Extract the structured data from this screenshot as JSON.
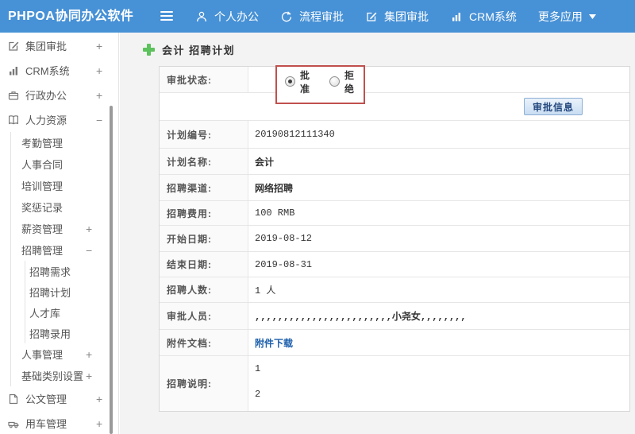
{
  "topbar": {
    "logo": "PHPOA协同办公软件",
    "nav": [
      {
        "label": "个人办公",
        "icon": "user-icon"
      },
      {
        "label": "流程审批",
        "icon": "process-icon"
      },
      {
        "label": "集团审批",
        "icon": "edit-square-icon"
      },
      {
        "label": "CRM系统",
        "icon": "bar-chart-icon"
      },
      {
        "label": "更多应用",
        "icon": "caret-down-icon"
      }
    ]
  },
  "sidebar": {
    "items": [
      {
        "label": "集团审批",
        "level": 0,
        "icon": "edit-square-icon",
        "expander": "+"
      },
      {
        "label": "CRM系统",
        "level": 0,
        "icon": "bar-chart-icon",
        "expander": "+"
      },
      {
        "label": "行政办公",
        "level": 0,
        "icon": "briefcase-icon",
        "expander": "+"
      },
      {
        "label": "人力资源",
        "level": 0,
        "icon": "book-icon",
        "expander": "−"
      },
      {
        "label": "考勤管理",
        "level": 1
      },
      {
        "label": "人事合同",
        "level": 1
      },
      {
        "label": "培训管理",
        "level": 1
      },
      {
        "label": "奖惩记录",
        "level": 1
      },
      {
        "label": "薪资管理",
        "level": 1,
        "expander": "+"
      },
      {
        "label": "招聘管理",
        "level": 1,
        "expander": "−"
      },
      {
        "label": "招聘需求",
        "level": 2
      },
      {
        "label": "招聘计划",
        "level": 2
      },
      {
        "label": "人才库",
        "level": 2
      },
      {
        "label": "招聘录用",
        "level": 2
      },
      {
        "label": "人事管理",
        "level": 1,
        "expander": "+"
      },
      {
        "label": "基础类别设置",
        "level": 1,
        "expander": "+"
      },
      {
        "label": "公文管理",
        "level": 0,
        "icon": "document-icon",
        "expander": "+"
      },
      {
        "label": "用车管理",
        "level": 0,
        "icon": "car-icon",
        "expander": "+"
      }
    ]
  },
  "main": {
    "title": "会计 招聘计划",
    "approval": {
      "label": "审批状态:",
      "options": [
        {
          "label": "批准",
          "selected": true
        },
        {
          "label": "拒绝",
          "selected": false
        }
      ]
    },
    "approval_info_button": "审批信息",
    "fields": [
      {
        "label": "计划编号:",
        "value": "20190812111340"
      },
      {
        "label": "计划名称:",
        "value": "会计",
        "bold": true
      },
      {
        "label": "招聘渠道:",
        "value": "网络招聘",
        "bold": true
      },
      {
        "label": "招聘费用:",
        "value": "100 RMB"
      },
      {
        "label": "开始日期:",
        "value": "2019-08-12"
      },
      {
        "label": "结束日期:",
        "value": "2019-08-31"
      },
      {
        "label": "招聘人数:",
        "value": "1 人"
      },
      {
        "label": "审批人员:",
        "value": ",,,,,,,,,,,,,,,,,,,,,,,,小尧女,,,,,,,,",
        "bold": true
      },
      {
        "label": "附件文档:",
        "value": "附件下载",
        "link": true
      },
      {
        "label": "招聘说明:",
        "lines": [
          "1",
          "2"
        ]
      }
    ],
    "colors": {
      "topbar_bg": "#4791d6",
      "annotation_red": "#c0504d",
      "plus_green": "#5cc25c",
      "link_blue": "#1c5fab",
      "button_text": "#23477d",
      "button_border": "#8cb0d4",
      "sidebar_scrollbar": "#9a9a9a"
    }
  }
}
